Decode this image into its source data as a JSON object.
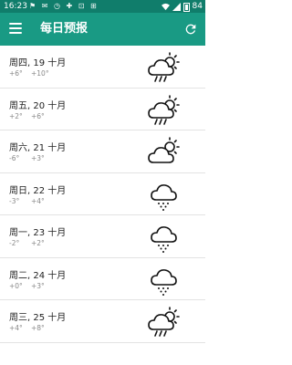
{
  "status_bar": {
    "time": "16:23",
    "left_glyphs": "⚑ ✉ ◷ ✚ ⊡ ⊞",
    "battery": "84"
  },
  "app_bar": {
    "title": "每日预报",
    "menu_icon": "hamburger-menu-icon",
    "refresh_icon": "refresh-icon"
  },
  "forecast": [
    {
      "date": "周四, 19 十月",
      "low": "+6°",
      "high": "+10°",
      "icon": "sun-cloud-rain"
    },
    {
      "date": "周五, 20 十月",
      "low": "+2°",
      "high": "+6°",
      "icon": "sun-cloud-rain"
    },
    {
      "date": "周六, 21 十月",
      "low": "-6°",
      "high": "+3°",
      "icon": "sun-cloud"
    },
    {
      "date": "周日, 22 十月",
      "low": "-3°",
      "high": "+4°",
      "icon": "cloud-snow"
    },
    {
      "date": "周一, 23 十月",
      "low": "-2°",
      "high": "+2°",
      "icon": "cloud-snow"
    },
    {
      "date": "周二, 24 十月",
      "low": "+0°",
      "high": "+3°",
      "icon": "cloud-snow"
    },
    {
      "date": "周三, 25 十月",
      "low": "+4°",
      "high": "+8°",
      "icon": "sun-cloud-rain"
    }
  ]
}
